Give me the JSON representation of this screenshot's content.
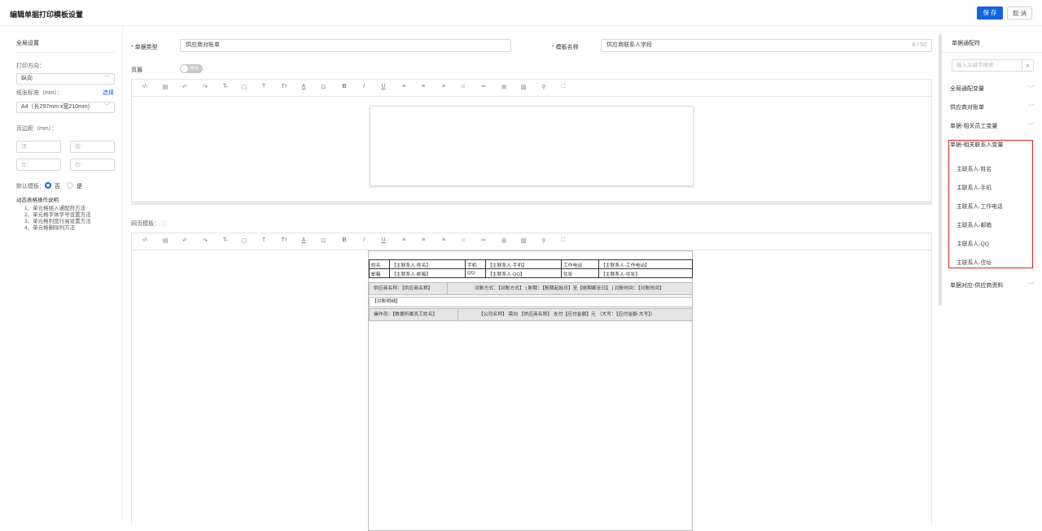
{
  "header": {
    "title": "编辑单据打印模板设置",
    "save": "保 存",
    "cancel": "取 消"
  },
  "left": {
    "section": "全局设置",
    "orientation_label": "打印方向：",
    "orientation_value": "纵向",
    "paper_label": "纸张标准（mm）：",
    "paper_select": "选择",
    "paper_value": "A4（长297mm x宽210mm)",
    "margin_label": "页边距（mm）：",
    "margin_top": "顶：",
    "margin_bottom": "底：",
    "margin_left": "左：",
    "margin_right": "右：",
    "default_label": "默认模板：",
    "no": "否",
    "yes": "是",
    "help_title": "动态表格操作说明",
    "help": [
      "1、单元格插入通配符方法",
      "2、单元格字体字号设置方法",
      "3、单元格列宽行高设置方法",
      "4、单元格删除列方法"
    ]
  },
  "form": {
    "type_label": "单据类型",
    "type_value": "供应商对账单",
    "name_label": "模板名称",
    "name_value": "供应商联系人字段",
    "name_count": "8 / 50",
    "header_label": "页眉",
    "toggle": "停用",
    "web_label": "网页模板："
  },
  "template": {
    "rows": [
      [
        "姓名",
        "【主联系人-姓名】",
        "手机",
        "【主联系人-手机】",
        "工作电话",
        "【主联系人-工作电话】"
      ],
      [
        "邮箱",
        "【主联系人-邮箱】",
        "QQ",
        "【主联系人-QQ】",
        "住址",
        "【主联系人-住址】"
      ]
    ],
    "bar1_left": "供应商名称：【供应商名称】",
    "bar1_right": "对账方式：【对账方式】 | 账期：【账期起始日】至【账期截至日】 | 对账时间：【对账时间】",
    "detail": "【对账明细】",
    "bar2_left": "操作员：【数据所属员工姓名】",
    "bar2_right": "【公司名称】 需向 【供应商名称】 支付【应付金额】元 （大写：【应付金额-大写】）"
  },
  "right": {
    "title": "单据通配符",
    "search_placeholder": "输入关键字搜索",
    "groups": [
      "全局通配变量",
      "供应商对账单",
      "单据-相关员工变量",
      "单据-相关联系人变量",
      "单据对应-供应商资料"
    ],
    "contact_items": [
      "主联系人-姓名",
      "主联系人-手机",
      "主联系人-工作电话",
      "主联系人-邮箱",
      "主联系人-QQ",
      "主联系人-住址"
    ],
    "highlight_color": "#e02020"
  }
}
